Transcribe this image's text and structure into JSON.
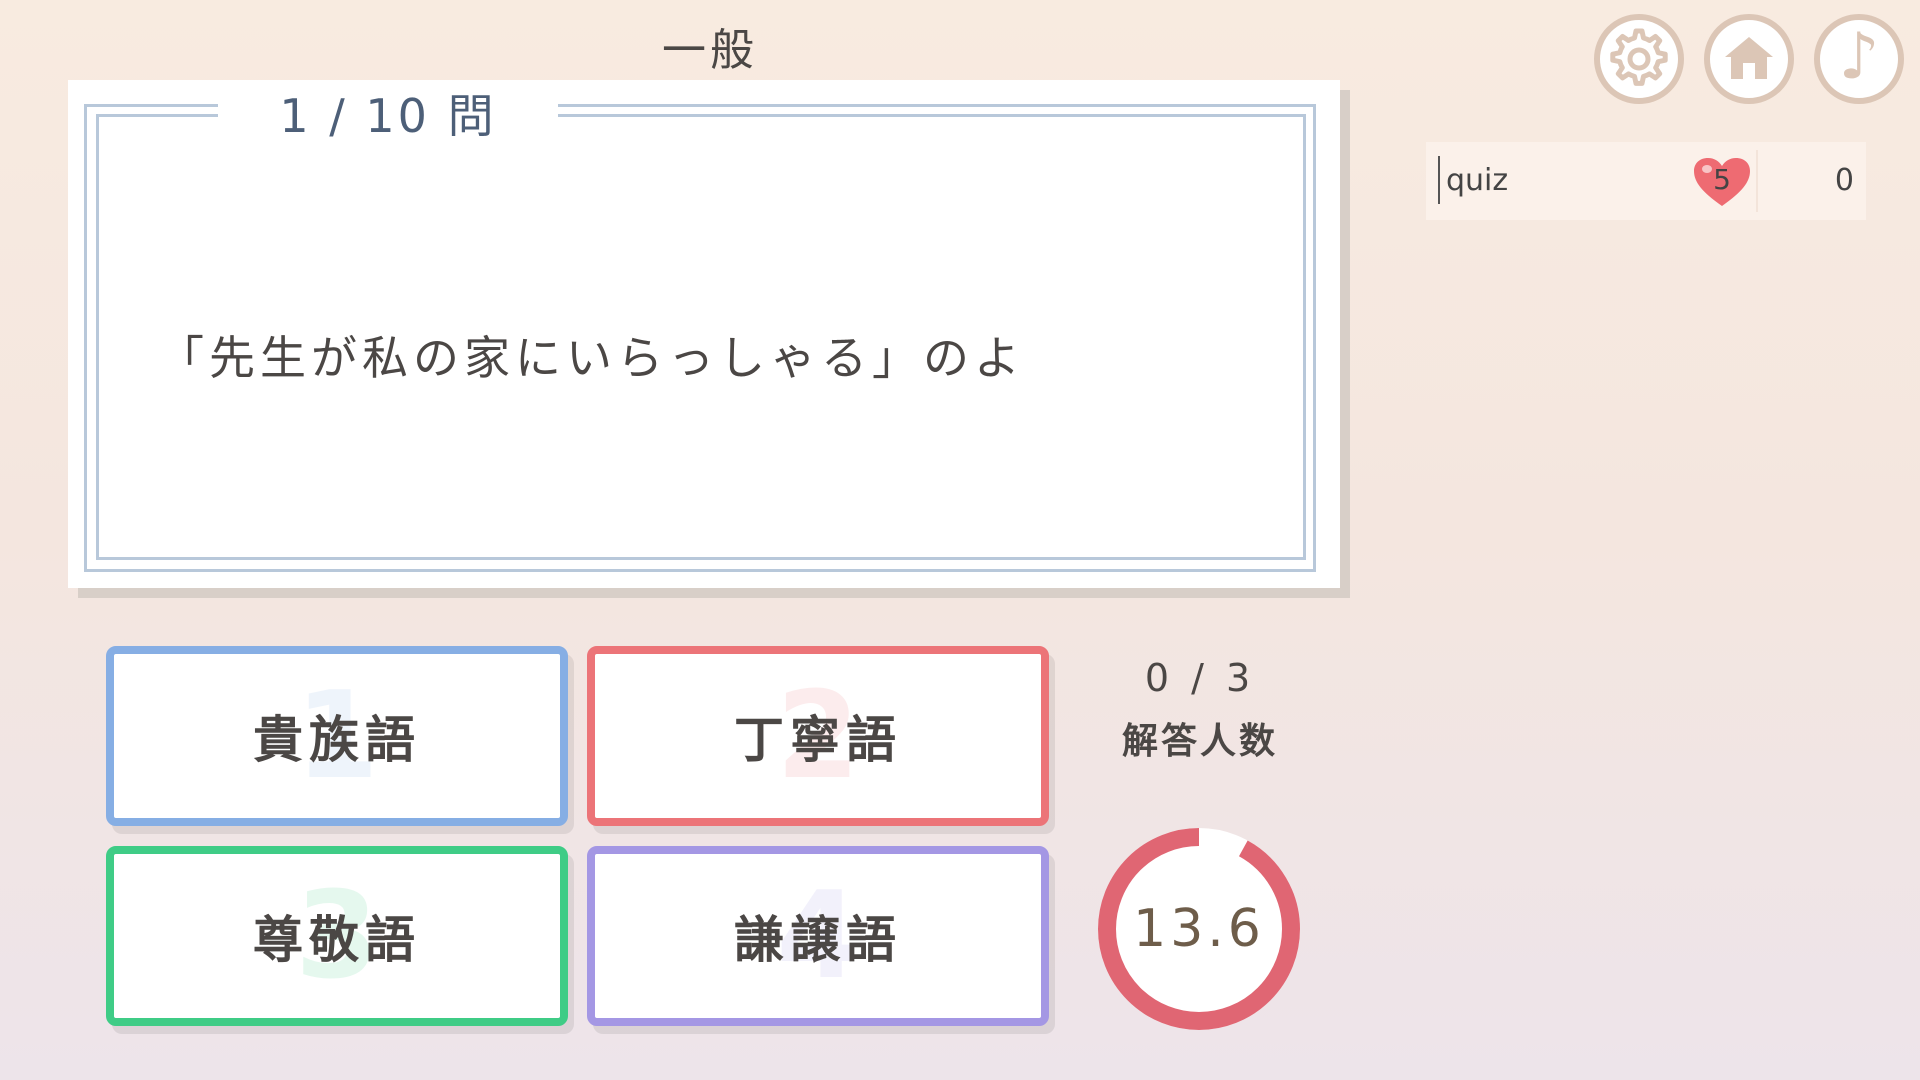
{
  "header": {
    "category": "一般"
  },
  "question": {
    "counter": "1 / 10 問",
    "text": "「先生が私の家にいらっしゃる」のよ"
  },
  "answers": [
    {
      "number": "1",
      "label": "貴族語",
      "color": "#86aee4"
    },
    {
      "number": "2",
      "label": "丁寧語",
      "color": "#ec7478"
    },
    {
      "number": "3",
      "label": "尊敬語",
      "color": "#3fcc86"
    },
    {
      "number": "4",
      "label": "謙譲語",
      "color": "#a497e4"
    }
  ],
  "status": {
    "answered": "0 / 3",
    "answered_label": "解答人数",
    "timer": "13.6",
    "timer_fraction_remaining": 0.92,
    "timer_color": "#e06673"
  },
  "toolbar": {
    "settings_icon": "gear-icon",
    "home_icon": "home-icon",
    "music_icon": "music-note-icon",
    "music_glyph": "♪"
  },
  "player": {
    "name": "quiz",
    "lives": "5",
    "score": "0",
    "heart_color": "#ee6b72"
  }
}
